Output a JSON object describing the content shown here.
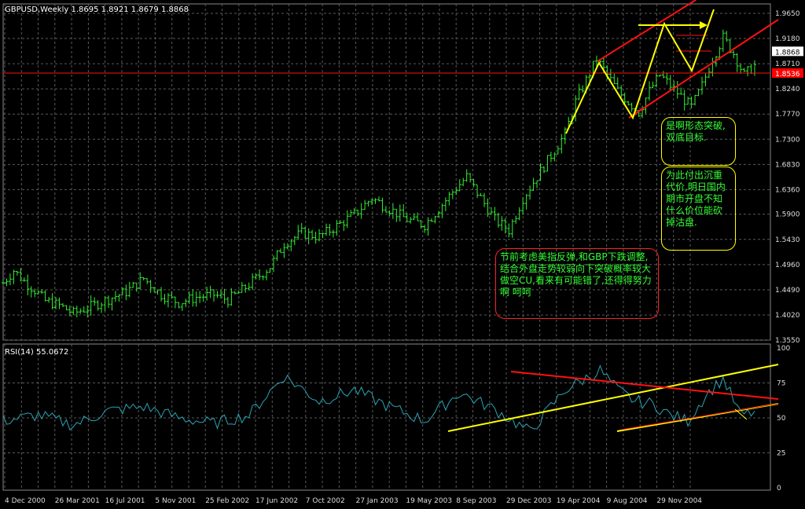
{
  "header": {
    "title": "GBPUSD,Weekly  1.8695 1.8921 1.8679 1.8868",
    "rsi_label": "RSI(14)  55.0672"
  },
  "price_axis": {
    "ticks": [
      "1.9650",
      "1.9180",
      "1.8710",
      "1.8240",
      "1.7770",
      "1.7300",
      "1.6830",
      "1.6360",
      "1.5900",
      "1.5430",
      "1.4960",
      "1.4490",
      "1.4020",
      "1.3550"
    ],
    "current_price": "1.8868",
    "line_price": "1.8536",
    "current_price_value": 1.8868,
    "line_price_value": 1.8536,
    "ylim": [
      1.355,
      1.965
    ]
  },
  "rsi_axis": {
    "ticks": [
      "100",
      "75",
      "50",
      "25",
      "0"
    ],
    "ylim": [
      0,
      100
    ]
  },
  "time_axis": {
    "ticks": [
      "4 Dec 2000",
      "26 Mar 2001",
      "16 Jul 2001",
      "5 Nov 2001",
      "25 Feb 2002",
      "17 Jun 2002",
      "7 Oct 2002",
      "27 Jan 2003",
      "19 May 2003",
      "8 Sep 2003",
      "29 Dec 2003",
      "19 Apr 2004",
      "9 Aug 2004",
      "29 Nov 2004"
    ]
  },
  "notes": {
    "note1": "是啊形态突破,双底目标.",
    "note2": "为此付出沉重代价,明日国内期市开盘不知什么价位能砍掉沽盘.",
    "note3": "节前考虑美指反弹,和GBP下跌调整,结合外盘走势较弱向下突破概率较大做空CU,看来有可能错了,还得得努力啊 呵呵"
  },
  "colors": {
    "background": "#000000",
    "grid": "#5a5a5a",
    "candles": "#33ee33",
    "rsi_line": "#2aa5b5",
    "trend_red": "#ff1111",
    "trend_yellow": "#ffff00",
    "note_text": "#33ff33"
  },
  "chart_data": {
    "type": "candlestick",
    "title": "GBPUSD,Weekly",
    "x_range": [
      "4 Dec 2000",
      "Dec 2004"
    ],
    "series": [
      {
        "name": "GBPUSD",
        "points_x": [
          0,
          3,
          6,
          9,
          12,
          16,
          20,
          25,
          30,
          35,
          40,
          45,
          50,
          55,
          60,
          64,
          68,
          72,
          76,
          80,
          85,
          90,
          95,
          100,
          105,
          110,
          115,
          120,
          124,
          128,
          132,
          136,
          140,
          144,
          148,
          152,
          156,
          160,
          163,
          166,
          169,
          172,
          175,
          178,
          181,
          184,
          187,
          190,
          193,
          196,
          199,
          202,
          205,
          208,
          211,
          214
        ],
        "close": [
          1.462,
          1.485,
          1.465,
          1.448,
          1.428,
          1.42,
          1.405,
          1.418,
          1.432,
          1.445,
          1.47,
          1.44,
          1.425,
          1.435,
          1.44,
          1.43,
          1.448,
          1.47,
          1.492,
          1.535,
          1.555,
          1.548,
          1.568,
          1.59,
          1.62,
          1.6,
          1.58,
          1.57,
          1.6,
          1.632,
          1.66,
          1.62,
          1.58,
          1.56,
          1.62,
          1.66,
          1.7,
          1.74,
          1.8,
          1.84,
          1.88,
          1.85,
          1.82,
          1.8,
          1.78,
          1.82,
          1.85,
          1.83,
          1.81,
          1.79,
          1.83,
          1.88,
          1.92,
          1.89,
          1.85,
          1.868
        ]
      },
      {
        "name": "RSI(14)",
        "points_x": [
          0,
          10,
          20,
          30,
          40,
          50,
          60,
          70,
          80,
          90,
          100,
          110,
          120,
          130,
          140,
          150,
          160,
          170,
          175,
          180,
          185,
          190,
          195,
          200,
          205,
          210,
          214
        ],
        "values": [
          48,
          52,
          45,
          55,
          58,
          50,
          46,
          52,
          80,
          62,
          70,
          58,
          48,
          68,
          56,
          40,
          70,
          84,
          70,
          62,
          60,
          52,
          48,
          66,
          78,
          52,
          54
        ]
      }
    ]
  }
}
